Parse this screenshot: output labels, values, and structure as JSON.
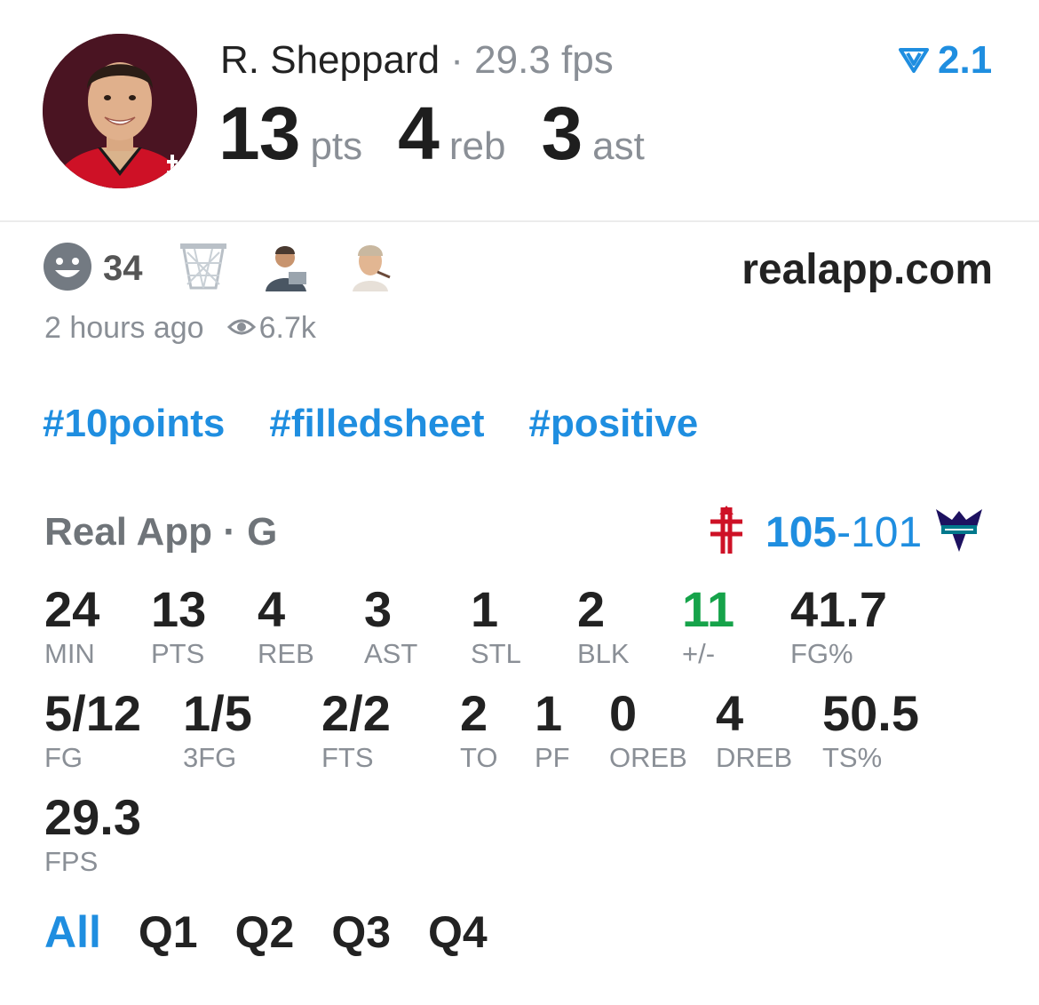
{
  "player": {
    "name": "R. Sheppard",
    "separator": " · ",
    "fps_line": "29.3 fps",
    "rating": "2.1",
    "pts": "13",
    "pts_unit": "pts",
    "reb": "4",
    "reb_unit": "reb",
    "ast": "3",
    "ast_unit": "ast"
  },
  "reactions": {
    "count": "34",
    "site": "realapp.com",
    "time_ago": "2 hours ago",
    "views": "6.7k"
  },
  "hashtags": [
    "#10points",
    "#filledsheet",
    "#positive"
  ],
  "game": {
    "league": "Real App · G",
    "home_score": "105",
    "dash": "-",
    "away_score": "101"
  },
  "stats": [
    {
      "value": "24",
      "label": "MIN"
    },
    {
      "value": "13",
      "label": "PTS"
    },
    {
      "value": "4",
      "label": "REB"
    },
    {
      "value": "3",
      "label": "AST"
    },
    {
      "value": "1",
      "label": "STL"
    },
    {
      "value": "2",
      "label": "BLK"
    },
    {
      "value": "11",
      "label": "+/-"
    },
    {
      "value": "41.7",
      "label": "FG%"
    },
    {
      "value": "5/12",
      "label": "FG"
    },
    {
      "value": "1/5",
      "label": "3FG"
    },
    {
      "value": "2/2",
      "label": "FTS"
    },
    {
      "value": "2",
      "label": "TO"
    },
    {
      "value": "1",
      "label": "PF"
    },
    {
      "value": "0",
      "label": "OREB"
    },
    {
      "value": "4",
      "label": "DREB"
    },
    {
      "value": "50.5",
      "label": "TS%"
    },
    {
      "value": "29.3",
      "label": "FPS"
    }
  ],
  "tabs": [
    "All",
    "Q1",
    "Q2",
    "Q3",
    "Q4"
  ],
  "colors": {
    "accent": "#1f8ee0",
    "positive": "#16a34a",
    "muted": "#8a8f96"
  },
  "icons": {
    "rating": "rating-chevron-icon",
    "smiley": "smiley-icon",
    "basket": "basketball-hoop-icon",
    "views": "eye-icon",
    "home_team": "rockets-logo-icon",
    "away_team": "hornets-logo-icon"
  }
}
